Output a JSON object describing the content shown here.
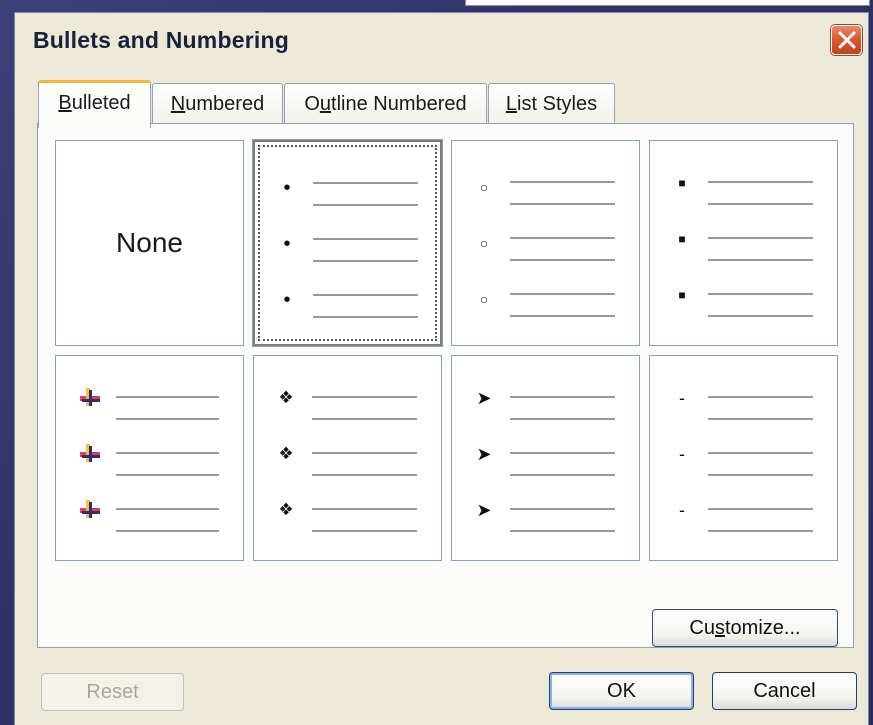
{
  "dialog": {
    "title": "Bullets and Numbering"
  },
  "tabs": [
    {
      "label_ul": "B",
      "label_rest": "ulleted",
      "active": true
    },
    {
      "label_ul": "N",
      "label_rest": "umbered",
      "active": false
    },
    {
      "label_pre": "O",
      "label_ul": "u",
      "label_rest": "tline Numbered",
      "active": false
    },
    {
      "label_ul": "L",
      "label_rest": "ist Styles",
      "active": false
    }
  ],
  "bullet_options": [
    {
      "name": "None",
      "glyph": "",
      "selected": false
    },
    {
      "name": "filled-circle",
      "glyph": "•",
      "selected": true
    },
    {
      "name": "hollow-circle",
      "glyph": "○",
      "selected": false
    },
    {
      "name": "filled-square",
      "glyph": "■",
      "selected": false
    },
    {
      "name": "colored-cross",
      "glyph": "",
      "selected": false
    },
    {
      "name": "four-diamond",
      "glyph": "❖",
      "selected": false
    },
    {
      "name": "arrowhead",
      "glyph": "➤",
      "selected": false
    },
    {
      "name": "dash",
      "glyph": "-",
      "selected": false
    }
  ],
  "buttons": {
    "customize_pre": "Cu",
    "customize_ul": "s",
    "customize_rest": "tomize...",
    "reset": "Reset",
    "ok": "OK",
    "cancel": "Cancel"
  },
  "colors": {
    "dialog_bg": "#ece9d8",
    "tab_active_accent": "#f6b33a",
    "close_button": "#d95a35"
  }
}
